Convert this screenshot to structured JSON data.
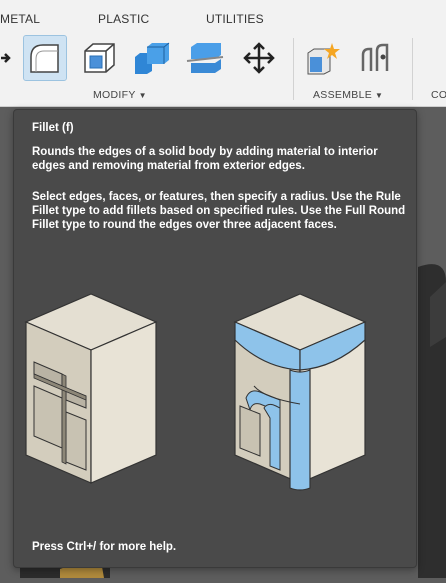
{
  "ribbon": {
    "tabs": [
      {
        "label": "METAL"
      },
      {
        "label": "PLASTIC"
      },
      {
        "label": "UTILITIES"
      }
    ],
    "groups": {
      "modify": {
        "label": "MODIFY"
      },
      "assemble": {
        "label": "ASSEMBLE"
      },
      "partial": {
        "label": "CO"
      }
    },
    "tools": [
      {
        "icon": "move-arrow-icon-partial"
      },
      {
        "icon": "fillet-icon"
      },
      {
        "icon": "shell-icon"
      },
      {
        "icon": "combine-icon"
      },
      {
        "icon": "split-body-icon"
      },
      {
        "icon": "move-icon"
      },
      {
        "icon": "new-component-icon"
      },
      {
        "icon": "joint-icon"
      }
    ]
  },
  "tooltip": {
    "title": "Fillet (f)",
    "description": "Rounds the edges of a solid body by adding material to interior edges and removing material from exterior edges.",
    "instructions": "Select edges, faces, or features, then specify a radius. Use the Rule Fillet type to add fillets based on specified rules. Use the Full Round Fillet type to round the edges over three adjacent faces.",
    "help": "Press Ctrl+/ for more help."
  },
  "colors": {
    "accent_blue": "#4a90d9",
    "fillet_blue": "#8ec3ea",
    "body_beige": "#e0dacb",
    "tooltip_bg": "#4a4a4a"
  }
}
